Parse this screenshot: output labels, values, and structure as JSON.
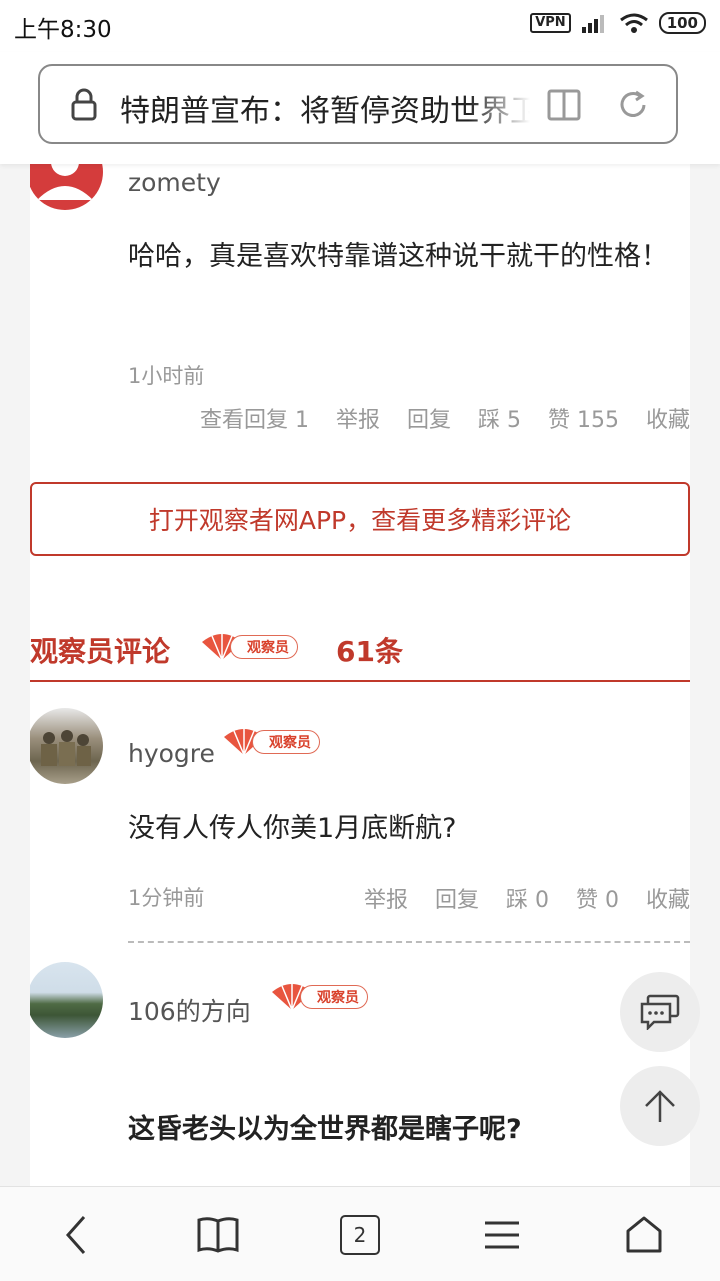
{
  "status_bar": {
    "time": "上午8:30",
    "vpn": "VPN",
    "battery": "100"
  },
  "address_bar": {
    "title": "特朗普宣布：将暂停资助世界卫生组织"
  },
  "comments": [
    {
      "username": "zomety",
      "text": "哈哈，真是喜欢特靠谱这种说干就干的性格！",
      "time": "1小时前",
      "actions": {
        "view_replies": "查看回复 1",
        "report": "举报",
        "reply": "回复",
        "dislike": "踩 5",
        "like": "赞 155",
        "favorite": "收藏"
      }
    }
  ],
  "cta": {
    "label": "打开观察者网APP，查看更多精彩评论"
  },
  "observer_section": {
    "title": "观察员评论",
    "badge": "观察员",
    "count": "61条",
    "comments": [
      {
        "username": "hyogre",
        "badge": "观察员",
        "text": "没有人传人你美1月底断航?",
        "time": "1分钟前",
        "actions": {
          "report": "举报",
          "reply": "回复",
          "dislike": "踩 0",
          "like": "赞 0",
          "favorite": "收藏"
        }
      },
      {
        "username": "106的方向",
        "badge": "观察员",
        "text": "这昏老头以为全世界都是瞎子呢?"
      }
    ]
  },
  "bottom_nav": {
    "tab_count": "2"
  },
  "colors": {
    "accent": "#c0392b",
    "badge": "#e8553f",
    "text_secondary": "#999999"
  }
}
